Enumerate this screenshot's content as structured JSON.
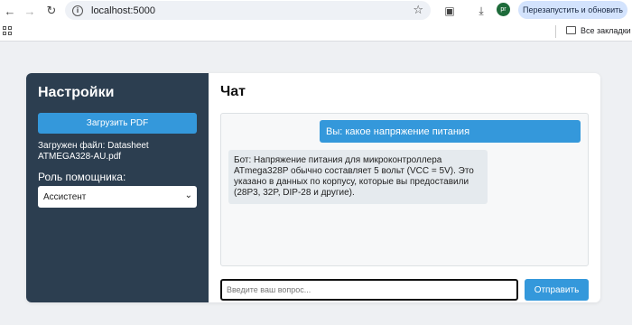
{
  "browser": {
    "url": "localhost:5000",
    "relaunch_label": "Перезапустить и обновить",
    "avatar_initials": "pr",
    "bookmarks_label": "Все закладки"
  },
  "sidebar": {
    "title": "Настройки",
    "upload_label": "Загрузить PDF",
    "file_status": "Загружен файл: Datasheet ATMEGA328-AU.pdf",
    "role_label": "Роль помощника:",
    "role_value": "Ассистент"
  },
  "chat": {
    "title": "Чат",
    "messages": [
      {
        "role": "user",
        "text": "Вы: какое напряжение питания"
      },
      {
        "role": "bot",
        "text": "Бот: Напряжение питания для микроконтроллера ATmega328P обычно составляет 5 вольт (VCC = 5V). Это указано в данных по корпусу, которые вы предоставили (28P3, 32P, DIP-28 и другие)."
      }
    ],
    "input_placeholder": "Введите ваш вопрос...",
    "send_label": "Отправить"
  },
  "colors": {
    "sidebar_bg": "#2c3e50",
    "accent": "#3498db",
    "page_bg": "#eef0f3"
  }
}
